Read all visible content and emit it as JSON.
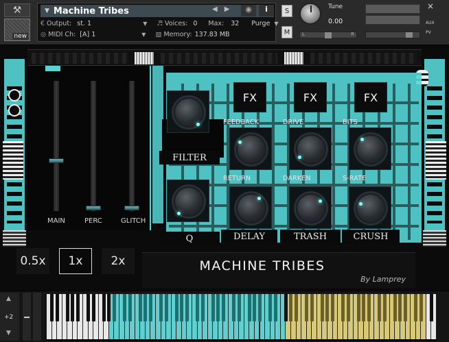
{
  "header": {
    "instrument_name": "Machine Tribes",
    "output_label": "Output:",
    "output_value": "st. 1",
    "voices_label": "Voices:",
    "voices_value": "0",
    "max_label": "Max:",
    "max_value": "32",
    "purge_label": "Purge",
    "midi_label": "MIDI Ch:",
    "midi_value": "[A]  1",
    "memory_label": "Memory:",
    "memory_value": "137.83 MB",
    "solo_label": "S",
    "mute_label": "M",
    "tune_label": "Tune",
    "tune_value": "0.00",
    "new_label": "new",
    "pan_left": "L",
    "pan_right": "R",
    "aux_label": "AUX",
    "pv_label": "PV",
    "close_glyph": "×"
  },
  "instrument": {
    "faders": [
      {
        "label": "MAIN",
        "level": 0.38
      },
      {
        "label": "PERC",
        "level": 0.0
      },
      {
        "label": "GLITCH",
        "level": 0.0
      }
    ],
    "fx_buttons": [
      "FX",
      "FX",
      "FX"
    ],
    "filter_label": "FILTER",
    "q_label": "Q",
    "knob_labels": {
      "feedback": "FEEDBACK",
      "drive": "DRIVE",
      "bits": "BITS",
      "return": "RETURN",
      "darken": "DARKEN",
      "s_rate": "S-RATE"
    },
    "section_labels": {
      "delay": "DELAY",
      "trash": "TRASH",
      "crush": "CRUSH"
    },
    "rates": [
      "0.5x",
      "1x",
      "2x"
    ],
    "selected_rate": "1x",
    "title": "MACHINE TRIBES",
    "author": "By Lamprey"
  },
  "keyboard": {
    "octave_value": "+2"
  },
  "colors": {
    "accent_cyan": "#55d5d6",
    "key_cyan": "#5fcfd0",
    "key_yellow": "#d8c976"
  }
}
